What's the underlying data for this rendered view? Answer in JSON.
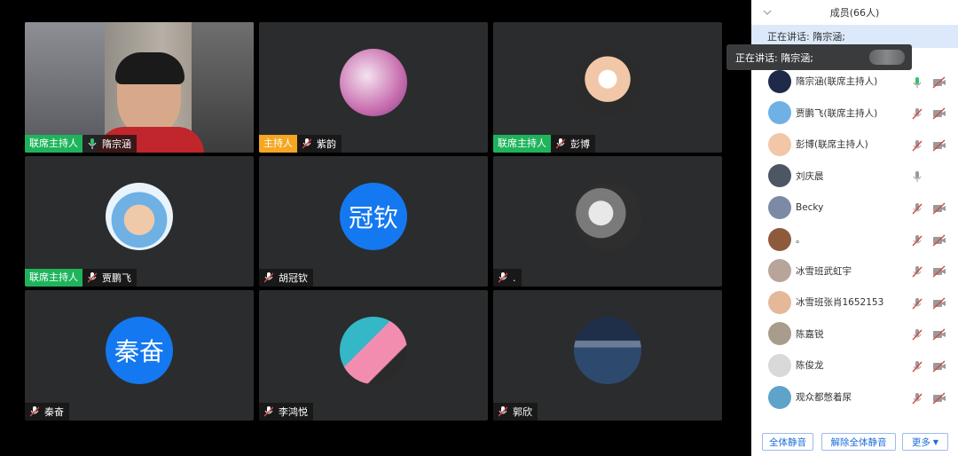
{
  "tiles": [
    {
      "id": "t1",
      "role": "联席主持人",
      "role_type": "cohost",
      "name": "隋宗涵",
      "video": true,
      "mic_state": "on"
    },
    {
      "id": "t2",
      "role": "主持人",
      "role_type": "host",
      "name": "紫韵",
      "mic_state": "muted",
      "avatar_color": "#d67bb8"
    },
    {
      "id": "t3",
      "role": "联席主持人",
      "role_type": "cohost",
      "name": "彭博",
      "mic_state": "muted",
      "avatar_color": "#f2c7a8"
    },
    {
      "id": "t4",
      "role": "联席主持人",
      "role_type": "cohost",
      "name": "贾鹏飞",
      "mic_state": "muted",
      "avatar_color": "#6fb0e5"
    },
    {
      "id": "t5",
      "role": "",
      "role_type": "",
      "name": "胡冠钦",
      "avatar_text": "冠钦",
      "mic_state": "muted"
    },
    {
      "id": "t6",
      "role": "",
      "role_type": "",
      "name": ".",
      "mic_state": "muted",
      "avatar_color": "#6b6b6b"
    },
    {
      "id": "t7",
      "role": "",
      "role_type": "",
      "name": "秦奋",
      "avatar_text": "秦奋",
      "mic_state": "muted"
    },
    {
      "id": "t8",
      "role": "",
      "role_type": "",
      "name": "李鸿悦",
      "mic_state": "muted",
      "avatar_color": "#34b7c7"
    },
    {
      "id": "t9",
      "role": "",
      "role_type": "",
      "name": "郭欣",
      "mic_state": "muted",
      "avatar_color": "#2d4a6e"
    }
  ],
  "panel": {
    "title": "成员(66人)",
    "speaking": "正在讲话: 隋宗涵;",
    "tooltip": "正在讲话: 隋宗涵;",
    "members": [
      {
        "name": "隋宗涵(联席主持人)",
        "mic": "on",
        "cam": true,
        "avatar_color": "#1e2a48"
      },
      {
        "name": "贾鹏飞(联席主持人)",
        "mic": "muted",
        "cam": true,
        "avatar_color": "#6fb0e5"
      },
      {
        "name": "彭博(联席主持人)",
        "mic": "muted",
        "cam": true,
        "avatar_color": "#f2c7a8"
      },
      {
        "name": "刘庆晨",
        "mic": "plain",
        "cam": false,
        "avatar_color": "#4e5563"
      },
      {
        "name": "Becky",
        "mic": "muted",
        "cam": true,
        "avatar_color": "#7d8aa6"
      },
      {
        "name": "。",
        "mic": "muted",
        "cam": true,
        "avatar_color": "#8e5a3c"
      },
      {
        "name": "冰雪班武虹宇",
        "mic": "muted",
        "cam": true,
        "avatar_color": "#b8a59a"
      },
      {
        "name": "冰雪班张肖1652153",
        "mic": "muted",
        "cam": true,
        "avatar_color": "#e5b89a"
      },
      {
        "name": "陈嘉锐",
        "mic": "muted",
        "cam": true,
        "avatar_color": "#a89c8c"
      },
      {
        "name": "陈俊龙",
        "mic": "muted",
        "cam": true,
        "avatar_color": "#d9d9d9"
      },
      {
        "name": "观众都憋着尿",
        "mic": "muted",
        "cam": true,
        "avatar_color": "#5ea3c9"
      }
    ],
    "buttons": {
      "mute_all": "全体静音",
      "unmute_all": "解除全体静音",
      "more": "更多"
    }
  },
  "colors": {
    "cohost": "#1fb45c",
    "host": "#f5a623",
    "accent": "#1478f0",
    "mic_on": "#2ec36b",
    "muted": "#d64848"
  }
}
